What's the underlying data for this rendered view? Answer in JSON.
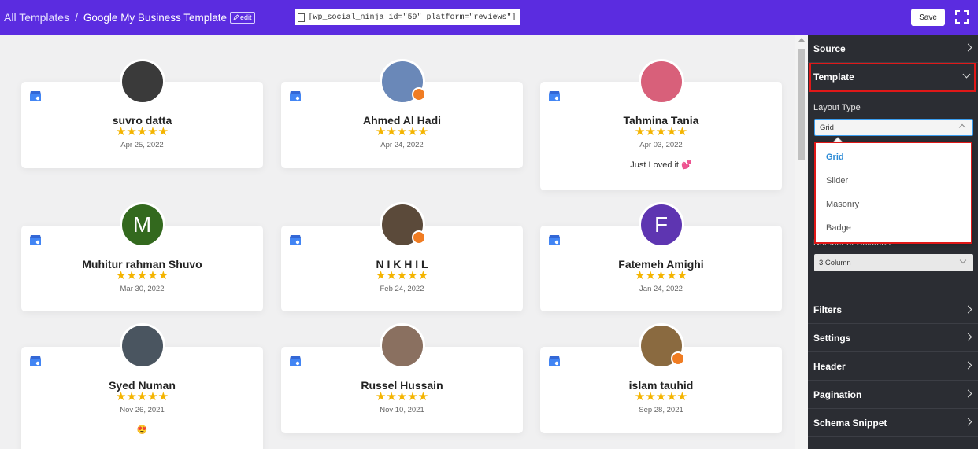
{
  "header": {
    "breadcrumb_root": "All Templates",
    "separator": "/",
    "title": "Google My Business Template",
    "edit_label": "edit",
    "shortcode": "[wp_social_ninja id=\"59\" platform=\"reviews\"]",
    "save_label": "Save",
    "bg_color": "#5b2ce0"
  },
  "reviews": [
    {
      "name": "suvro datta",
      "date": "Apr 25, 2022",
      "text": "",
      "stars": "★★★★★",
      "avatar_color": "#3a3a3a",
      "avatar_letter": ""
    },
    {
      "name": "Ahmed Al Hadi",
      "date": "Apr 24, 2022",
      "text": "",
      "stars": "★★★★★",
      "avatar_color": "#6a88b8",
      "avatar_letter": ""
    },
    {
      "name": "Tahmina Tania",
      "date": "Apr 03, 2022",
      "text": "Just Loved it 💕",
      "stars": "★★★★★",
      "avatar_color": "#d8607a",
      "avatar_letter": ""
    },
    {
      "name": "Muhitur rahman Shuvo",
      "date": "Mar 30, 2022",
      "text": "",
      "stars": "★★★★★",
      "avatar_color": "#33691e",
      "avatar_letter": "M"
    },
    {
      "name": "N I K H I L",
      "date": "Feb 24, 2022",
      "text": "",
      "stars": "★★★★★",
      "avatar_color": "#5b4a3a",
      "avatar_letter": ""
    },
    {
      "name": "Fatemeh Amighi",
      "date": "Jan 24, 2022",
      "text": "",
      "stars": "★★★★★",
      "avatar_color": "#5e35b1",
      "avatar_letter": "F"
    },
    {
      "name": "Syed Numan",
      "date": "Nov 26, 2021",
      "text": "😍",
      "stars": "★★★★★",
      "avatar_color": "#4a5560",
      "avatar_letter": ""
    },
    {
      "name": "Russel Hussain",
      "date": "Nov 10, 2021",
      "text": "",
      "stars": "★★★★★",
      "avatar_color": "#8a7060",
      "avatar_letter": ""
    },
    {
      "name": "islam tauhid",
      "date": "Sep 28, 2021",
      "text": "",
      "stars": "★★★★★",
      "avatar_color": "#8a6a40",
      "avatar_letter": ""
    }
  ],
  "sidebar": {
    "source": "Source",
    "template": "Template",
    "layout_type_label": "Layout Type",
    "layout_type_value": "Grid",
    "layout_options": [
      "Grid",
      "Slider",
      "Masonry",
      "Badge"
    ],
    "columns_label": "Number of Columns",
    "columns_value": "3 Column",
    "filters": "Filters",
    "settings": "Settings",
    "header": "Header",
    "pagination": "Pagination",
    "schema_snippet": "Schema Snippet"
  },
  "colors": {
    "star": "#f4b400",
    "highlight": "#e01818",
    "sidebar_bg": "#2b2d33",
    "dropdown_selected": "#2a8ad6"
  }
}
